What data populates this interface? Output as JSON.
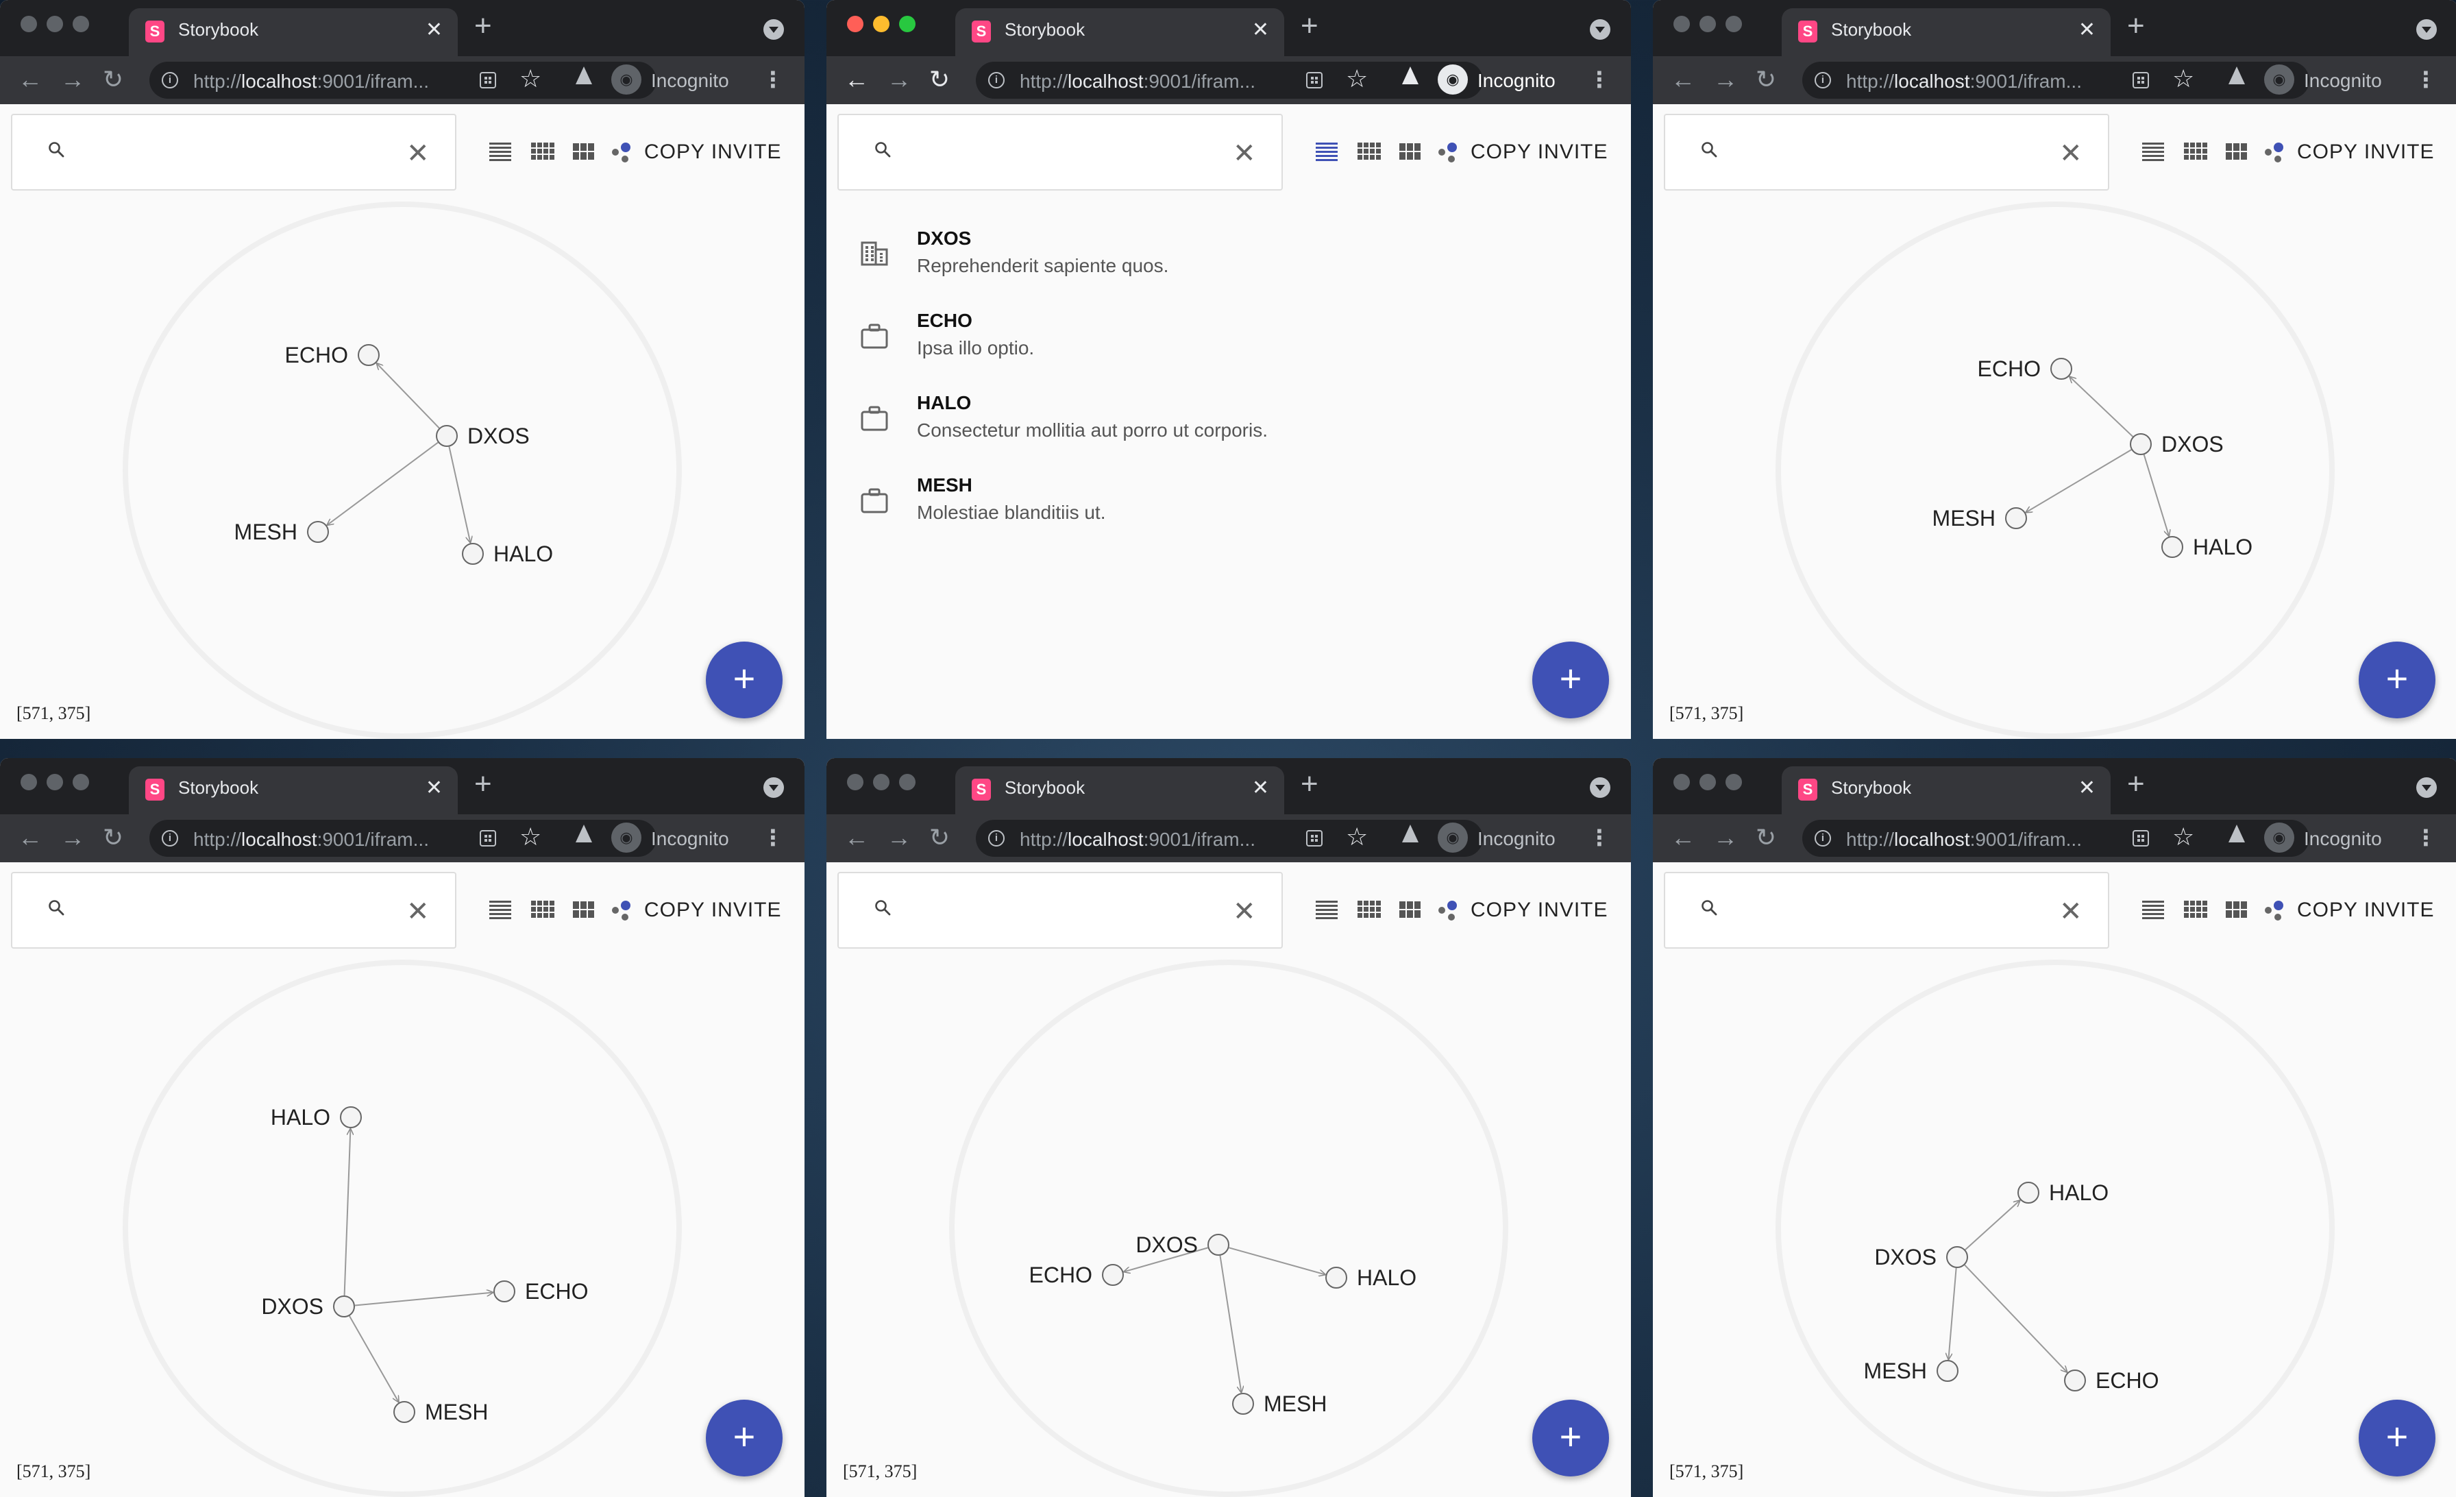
{
  "windows": [
    {
      "tab_title": "Storybook",
      "url_prefix": "http://",
      "url_host": "localhost",
      "url_rest": ":9001/ifram...",
      "incognito_label": "Incognito",
      "search": {
        "value": "",
        "placeholder": ""
      },
      "invite_label": "COPY INVITE",
      "coords": "[571, 375]",
      "fab_label": "+",
      "active": false,
      "view": "graph",
      "nodes": [
        {
          "id": "ECHO"
        },
        {
          "id": "DXOS"
        },
        {
          "id": "MESH"
        },
        {
          "id": "HALO"
        }
      ]
    },
    {
      "tab_title": "Storybook",
      "url_prefix": "http://",
      "url_host": "localhost",
      "url_rest": ":9001/ifram...",
      "incognito_label": "Incognito",
      "search": {
        "value": "",
        "placeholder": ""
      },
      "invite_label": "COPY INVITE",
      "fab_label": "+",
      "active": true,
      "view": "list",
      "items": [
        {
          "title": "DXOS",
          "subtitle": "Reprehenderit sapiente quos.",
          "icon": "business-icon"
        },
        {
          "title": "ECHO",
          "subtitle": "Ipsa illo optio.",
          "icon": "work-icon"
        },
        {
          "title": "HALO",
          "subtitle": "Consectetur mollitia aut porro ut corporis.",
          "icon": "work-icon"
        },
        {
          "title": "MESH",
          "subtitle": "Molestiae blanditiis ut.",
          "icon": "work-icon"
        }
      ]
    },
    {
      "tab_title": "Storybook",
      "url_prefix": "http://",
      "url_host": "localhost",
      "url_rest": ":9001/ifram...",
      "incognito_label": "Incognito",
      "search": {
        "value": "",
        "placeholder": ""
      },
      "invite_label": "COPY INVITE",
      "coords": "[571, 375]",
      "fab_label": "+",
      "active": false,
      "view": "graph",
      "nodes": [
        {
          "id": "ECHO"
        },
        {
          "id": "DXOS"
        },
        {
          "id": "MESH"
        },
        {
          "id": "HALO"
        }
      ]
    },
    {
      "tab_title": "Storybook",
      "url_prefix": "http://",
      "url_host": "localhost",
      "url_rest": ":9001/ifram...",
      "incognito_label": "Incognito",
      "search": {
        "value": "",
        "placeholder": ""
      },
      "invite_label": "COPY INVITE",
      "coords": "[571, 375]",
      "fab_label": "+",
      "active": false,
      "view": "graph",
      "nodes": [
        {
          "id": "HALO"
        },
        {
          "id": "DXOS"
        },
        {
          "id": "ECHO"
        },
        {
          "id": "MESH"
        }
      ]
    },
    {
      "tab_title": "Storybook",
      "url_prefix": "http://",
      "url_host": "localhost",
      "url_rest": ":9001/ifram...",
      "incognito_label": "Incognito",
      "search": {
        "value": "",
        "placeholder": ""
      },
      "invite_label": "COPY INVITE",
      "coords": "[571, 375]",
      "fab_label": "+",
      "active": false,
      "view": "graph",
      "nodes": [
        {
          "id": "DXOS"
        },
        {
          "id": "ECHO"
        },
        {
          "id": "HALO"
        },
        {
          "id": "MESH"
        }
      ]
    },
    {
      "tab_title": "Storybook",
      "url_prefix": "http://",
      "url_host": "localhost",
      "url_rest": ":9001/ifram...",
      "incognito_label": "Incognito",
      "search": {
        "value": "",
        "placeholder": ""
      },
      "invite_label": "COPY INVITE",
      "coords": "[571, 375]",
      "fab_label": "+",
      "active": false,
      "view": "graph",
      "nodes": [
        {
          "id": "HALO"
        },
        {
          "id": "DXOS"
        },
        {
          "id": "MESH"
        },
        {
          "id": "ECHO"
        }
      ]
    }
  ],
  "colors": {
    "accent": "#3f51b5",
    "browser_frame": "#202124",
    "browser_toolbar": "#35363a",
    "page_bg": "#fafafa",
    "storybook_pink": "#ff4785"
  }
}
